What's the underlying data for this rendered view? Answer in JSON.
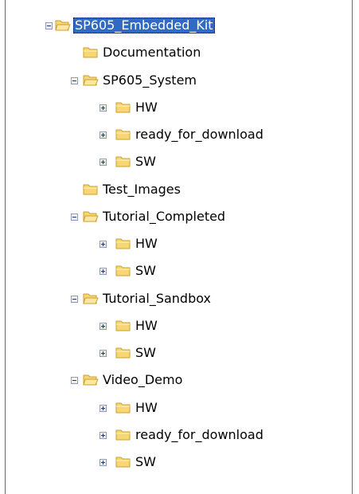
{
  "tree": {
    "nodes": [
      {
        "label": "SP605_Embedded_Kit",
        "depth": 0,
        "expander": "minus",
        "selected": true
      },
      {
        "label": "Documentation",
        "depth": 1,
        "expander": "none",
        "selected": false
      },
      {
        "label": "SP605_System",
        "depth": 1,
        "expander": "minus",
        "selected": false
      },
      {
        "label": "HW",
        "depth": 2,
        "expander": "plus",
        "selected": false
      },
      {
        "label": "ready_for_download",
        "depth": 2,
        "expander": "plus",
        "selected": false
      },
      {
        "label": "SW",
        "depth": 2,
        "expander": "plus",
        "selected": false
      },
      {
        "label": "Test_Images",
        "depth": 1,
        "expander": "none",
        "selected": false
      },
      {
        "label": "Tutorial_Completed",
        "depth": 1,
        "expander": "minus",
        "selected": false
      },
      {
        "label": "HW",
        "depth": 2,
        "expander": "plus",
        "selected": false
      },
      {
        "label": "SW",
        "depth": 2,
        "expander": "plus",
        "selected": false
      },
      {
        "label": "Tutorial_Sandbox",
        "depth": 1,
        "expander": "minus",
        "selected": false
      },
      {
        "label": "HW",
        "depth": 2,
        "expander": "plus",
        "selected": false
      },
      {
        "label": "SW",
        "depth": 2,
        "expander": "plus",
        "selected": false
      },
      {
        "label": "Video_Demo",
        "depth": 1,
        "expander": "minus",
        "selected": false
      },
      {
        "label": "HW",
        "depth": 2,
        "expander": "plus",
        "selected": false
      },
      {
        "label": "ready_for_download",
        "depth": 2,
        "expander": "plus",
        "selected": false
      },
      {
        "label": "SW",
        "depth": 2,
        "expander": "plus",
        "selected": false
      }
    ]
  },
  "colors": {
    "selection": "#316ac5",
    "folder_fill": "#f7d673",
    "folder_edge": "#c9a032"
  },
  "icons": {
    "folder": "folder-icon",
    "folder_open": "folder-open-icon",
    "expand": "expand-plus-icon",
    "collapse": "collapse-minus-icon"
  }
}
